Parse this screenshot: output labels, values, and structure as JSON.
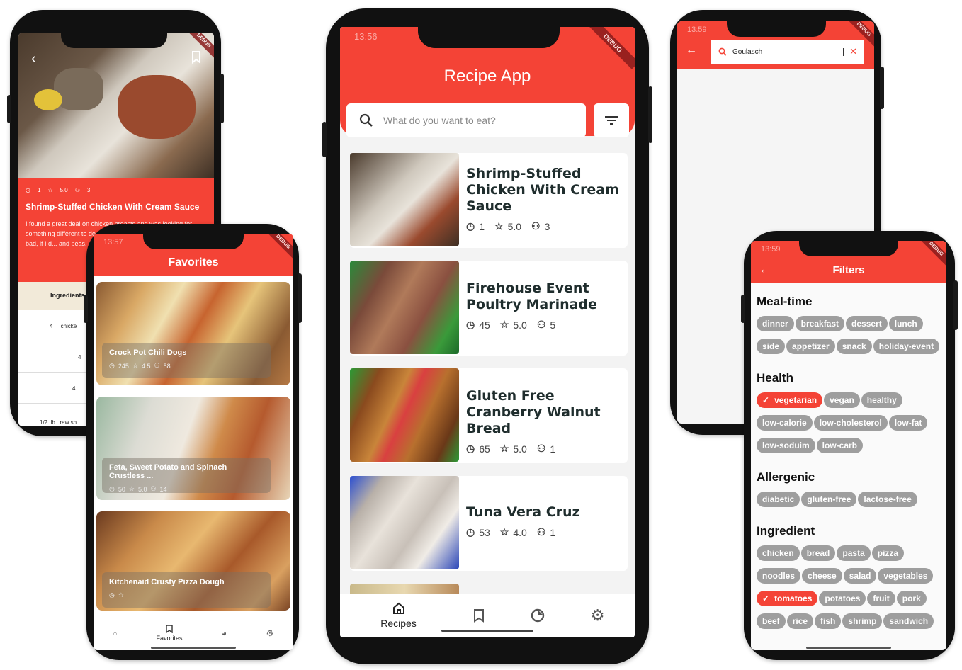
{
  "phone1": {
    "time": "",
    "debug": "DEBUG",
    "meta": {
      "time": "1",
      "rating": "5.0",
      "servings": "3"
    },
    "title": "Shrimp-Stuffed Chicken With Cream Sauce",
    "desc": "I found a great deal on chicken breasts and was looking for something different to do... been eating so much... it's not too bad, if I d... and peas.",
    "tab": "Ingredients",
    "ingredients": [
      {
        "qty": "4",
        "name": "chicke"
      },
      {
        "qty": "4",
        "name": ""
      },
      {
        "qty": "4",
        "name": ""
      },
      {
        "qty": "1/2",
        "unit": "lb",
        "name": "raw sh"
      }
    ]
  },
  "phone2": {
    "time": "13:56",
    "debug": "DEBUG",
    "app_title": "Recipe App",
    "search_placeholder": "What do you want to eat?",
    "recipes": [
      {
        "title": "Shrimp-Stuffed Chicken With Cream Sauce",
        "time": "1",
        "rating": "5.0",
        "servings": "3"
      },
      {
        "title": "Firehouse Event Poultry Marinade",
        "time": "45",
        "rating": "5.0",
        "servings": "5"
      },
      {
        "title": "Gluten Free Cranberry Walnut Bread",
        "time": "65",
        "rating": "5.0",
        "servings": "1"
      },
      {
        "title": "Tuna Vera Cruz",
        "time": "53",
        "rating": "4.0",
        "servings": "1"
      }
    ],
    "nav": {
      "recipes": "Recipes"
    }
  },
  "phone3": {
    "time": "13:57",
    "debug": "DEBUG",
    "title": "Favorites",
    "items": [
      {
        "title": "Crock Pot Chili Dogs",
        "time": "245",
        "rating": "4.5",
        "servings": "58"
      },
      {
        "title": "Feta, Sweet Potato and Spinach Crustless ...",
        "time": "50",
        "rating": "5.0",
        "servings": "14"
      },
      {
        "title": "Kitchenaid Crusty Pizza Dough",
        "time": "",
        "rating": "",
        "servings": ""
      }
    ],
    "nav": {
      "favorites": "Favorites"
    }
  },
  "phone4": {
    "time": "13:59",
    "debug": "DEBUG",
    "search_value": "Goulasch"
  },
  "phone5": {
    "time": "13:59",
    "debug": "DEBUG",
    "title": "Filters",
    "sections": [
      {
        "name": "Meal-time",
        "chips": [
          "dinner",
          "breakfast",
          "dessert",
          "lunch",
          "side",
          "appetizer",
          "snack",
          "holiday-event"
        ]
      },
      {
        "name": "Health",
        "chips": [
          "vegetarian",
          "vegan",
          "healthy",
          "low-calorie",
          "low-cholesterol",
          "low-fat",
          "low-soduim",
          "low-carb"
        ]
      },
      {
        "name": "Allergenic",
        "chips": [
          "diabetic",
          "gluten-free",
          "lactose-free"
        ]
      },
      {
        "name": "Ingredient",
        "chips": [
          "chicken",
          "bread",
          "pasta",
          "pizza",
          "noodles",
          "cheese",
          "salad",
          "vegetables",
          "tomatoes",
          "potatoes",
          "fruit",
          "pork",
          "beef",
          "rice",
          "fish",
          "shrimp",
          "sandwich"
        ]
      }
    ],
    "selected": [
      "vegetarian",
      "tomatoes"
    ]
  },
  "colors": {
    "primary": "#f44336",
    "chip": "#9e9e9e",
    "title": "#1f2d2d"
  }
}
